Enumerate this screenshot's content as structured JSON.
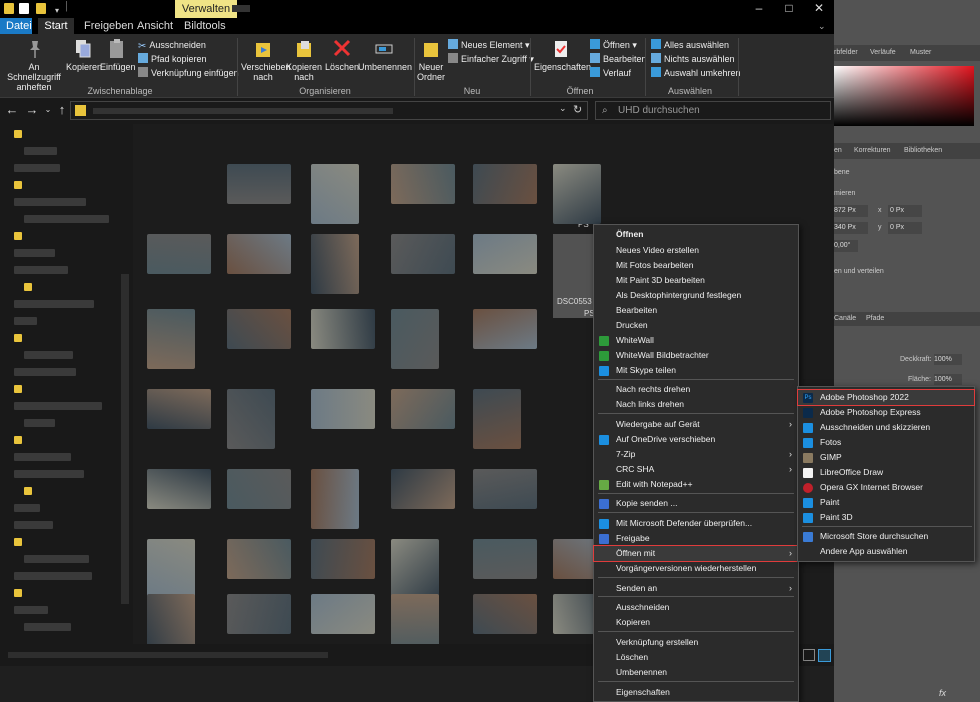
{
  "titlebar": {
    "manage_tab": "Verwalten",
    "minimize": "–",
    "maximize": "□",
    "close": "✕"
  },
  "ribbon_tabs": {
    "file": "Datei",
    "start": "Start",
    "share": "Freigeben",
    "view": "Ansicht",
    "picturetools": "Bildtools"
  },
  "ribbon": {
    "pin_quick": "An Schnellzugriff anheften",
    "copy": "Kopieren",
    "paste": "Einfügen",
    "cut": "Ausschneiden",
    "copy_path": "Pfad kopieren",
    "paste_shortcut": "Verknüpfung einfügen",
    "group_clipboard": "Zwischenablage",
    "move_to": "Verschieben nach",
    "copy_to": "Kopieren nach",
    "delete": "Löschen",
    "rename": "Umbenennen",
    "group_organize": "Organisieren",
    "new_folder": "Neuer Ordner",
    "new_item": "Neues Element",
    "easy_access": "Einfacher Zugriff",
    "group_new": "Neu",
    "properties": "Eigenschaften",
    "open": "Öffnen",
    "edit": "Bearbeiten",
    "history": "Verlauf",
    "group_open": "Öffnen",
    "select_all": "Alles auswählen",
    "select_none": "Nichts auswählen",
    "invert_selection": "Auswahl umkehren",
    "group_select": "Auswählen"
  },
  "address": {
    "search_placeholder": "UHD durchsuchen"
  },
  "selected_file": {
    "name": "DSC0553",
    "ext_top": "PS",
    "ext": "PS"
  },
  "context_menu": {
    "items": [
      "Öffnen",
      "Neues Video erstellen",
      "Mit Fotos bearbeiten",
      "Mit Paint 3D bearbeiten",
      "Als Desktophintergrund festlegen",
      "Bearbeiten",
      "Drucken",
      "WhiteWall",
      "WhiteWall Bildbetrachter",
      "Mit Skype teilen",
      "Nach rechts drehen",
      "Nach links drehen",
      "Wiedergabe auf Gerät",
      "Auf OneDrive verschieben",
      "7-Zip",
      "CRC SHA",
      "Edit with Notepad++",
      "Kopie senden ...",
      "Mit Microsoft Defender überprüfen...",
      "Freigabe",
      "Öffnen mit",
      "Vorgängerversionen wiederherstellen",
      "Senden an",
      "Ausschneiden",
      "Kopieren",
      "Verknüpfung erstellen",
      "Löschen",
      "Umbenennen",
      "Eigenschaften"
    ]
  },
  "submenu": {
    "items": [
      "Adobe Photoshop 2022",
      "Adobe Photoshop Express",
      "Ausschneiden und skizzieren",
      "Fotos",
      "GIMP",
      "LibreOffice Draw",
      "Opera GX Internet Browser",
      "Paint",
      "Paint 3D",
      "Microsoft Store durchsuchen",
      "Andere App auswählen"
    ],
    "icon_ps": "Ps"
  },
  "photoshop": {
    "tab_swatches": "rbfelder",
    "tab_gradients": "Verläufe",
    "tab_patterns": "Muster",
    "tab_properties": "en",
    "tab_adjustments": "Korrekturen",
    "tab_libraries": "Bibliotheken",
    "layer_label": "bene",
    "transform_label": "mieren",
    "w_val": "872 Px",
    "x_label": "x",
    "x_val": "0 Px",
    "h_val": "340 Px",
    "y_label": "y",
    "y_val": "0 Px",
    "angle": "0,00°",
    "align_label": "en und verteilen",
    "tab_channels": "Canäle",
    "tab_paths": "Pfade",
    "opacity_label": "Deckkraft:",
    "opacity_val": "100%",
    "fill_label": "Fläche:",
    "fill_val": "100%",
    "fx": "fx"
  },
  "colors": {
    "accent": "#1a7ac6",
    "highlight_border": "#e03c3c",
    "manage_tab": "#f0e386"
  }
}
